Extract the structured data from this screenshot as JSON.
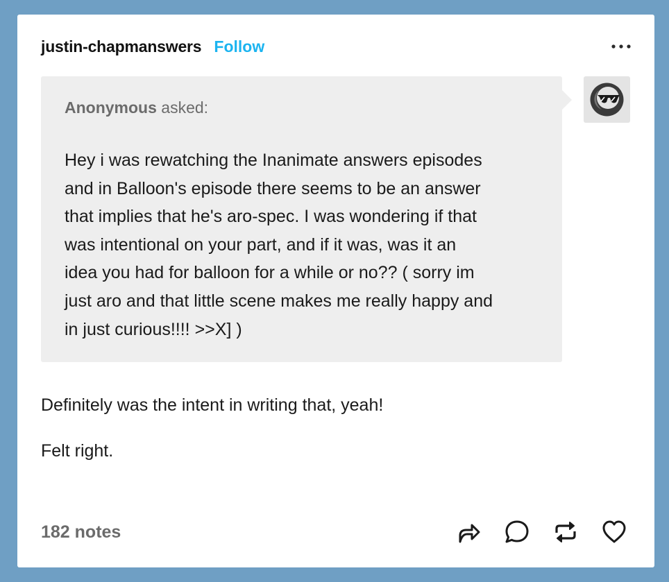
{
  "post": {
    "blog_name": "justin-chapmanswers",
    "follow_label": "Follow",
    "more_icon": "more-horizontal-icon",
    "ask": {
      "asker_name": "Anonymous",
      "asked_label": "asked:",
      "question": "Hey i was rewatching the Inanimate answers episodes and in Balloon's episode there seems to be an answer that implies that he's aro-spec. I was wondering if that was intentional on your part, and if it was, was it an idea you had for balloon for a while or no?? ( sorry im just aro and that little scene makes me really happy and in just curious!!!! >>X] )",
      "question_lines": [
        "Hey i was rewatching the Inanimate answers episodes",
        "and in Balloon's episode there seems to be an answer",
        "that implies that he's aro-spec. I was wondering if that",
        "was intentional on your part, and if it was, was it an",
        "idea you had for balloon for a while or no?? ( sorry im",
        "just aro and that little scene makes me really happy and",
        "in just curious!!!! >>X] )"
      ],
      "avatar_icon": "anonymous-sunglasses-avatar-icon"
    },
    "answer": [
      "Definitely was the intent in writing that, yeah!",
      "Felt right."
    ],
    "footer": {
      "notes": "182 notes",
      "actions": [
        {
          "name": "share",
          "icon": "share-icon"
        },
        {
          "name": "reply",
          "icon": "reply-icon"
        },
        {
          "name": "reblog",
          "icon": "reblog-icon"
        },
        {
          "name": "like",
          "icon": "heart-icon"
        }
      ]
    }
  },
  "colors": {
    "page_background": "#6f9fc4",
    "card_background": "#ffffff",
    "ask_background": "#eeeeee",
    "follow_accent": "#1cb4f0",
    "text_primary": "#1a1a1a",
    "text_muted": "#6b6b6b"
  }
}
